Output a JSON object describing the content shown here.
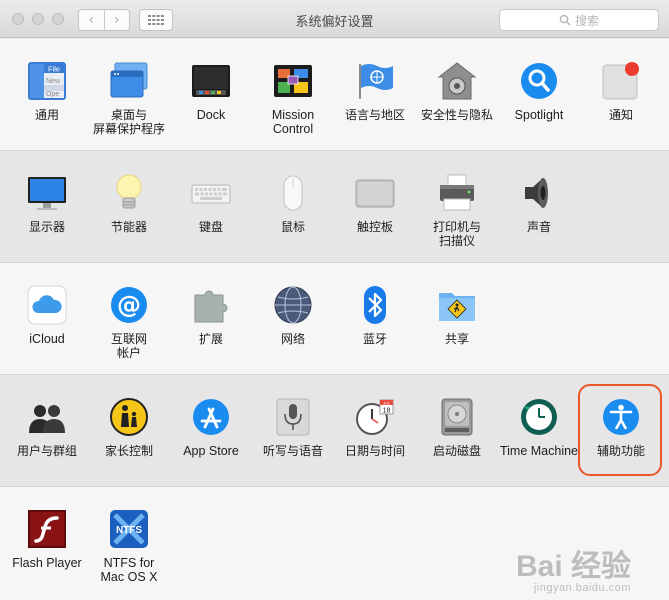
{
  "window": {
    "title": "系统偏好设置"
  },
  "toolbar": {
    "back": "‹",
    "forward": "›",
    "search_placeholder": "搜索"
  },
  "rows": [
    [
      {
        "name": "general",
        "label": "通用"
      },
      {
        "name": "desktop-screensaver",
        "label": "桌面与\n屏幕保护程序"
      },
      {
        "name": "dock",
        "label": "Dock"
      },
      {
        "name": "mission-control",
        "label": "Mission\nControl"
      },
      {
        "name": "language-region",
        "label": "语言与地区"
      },
      {
        "name": "security-privacy",
        "label": "安全性与隐私"
      },
      {
        "name": "spotlight",
        "label": "Spotlight"
      },
      {
        "name": "notifications",
        "label": "通知"
      }
    ],
    [
      {
        "name": "displays",
        "label": "显示器"
      },
      {
        "name": "energy-saver",
        "label": "节能器"
      },
      {
        "name": "keyboard",
        "label": "键盘"
      },
      {
        "name": "mouse",
        "label": "鼠标"
      },
      {
        "name": "trackpad",
        "label": "触控板"
      },
      {
        "name": "printers-scanners",
        "label": "打印机与\n扫描仪"
      },
      {
        "name": "sound",
        "label": "声音"
      }
    ],
    [
      {
        "name": "icloud",
        "label": "iCloud"
      },
      {
        "name": "internet-accounts",
        "label": "互联网\n帐户"
      },
      {
        "name": "extensions",
        "label": "扩展"
      },
      {
        "name": "network",
        "label": "网络"
      },
      {
        "name": "bluetooth",
        "label": "蓝牙"
      },
      {
        "name": "sharing",
        "label": "共享"
      }
    ],
    [
      {
        "name": "users-groups",
        "label": "用户与群组"
      },
      {
        "name": "parental-controls",
        "label": "家长控制"
      },
      {
        "name": "app-store",
        "label": "App Store"
      },
      {
        "name": "dictation-speech",
        "label": "听写与语音"
      },
      {
        "name": "date-time",
        "label": "日期与时间"
      },
      {
        "name": "startup-disk",
        "label": "启动磁盘"
      },
      {
        "name": "time-machine",
        "label": "Time Machine"
      },
      {
        "name": "accessibility",
        "label": "辅助功能"
      }
    ],
    [
      {
        "name": "flash-player",
        "label": "Flash Player"
      },
      {
        "name": "ntfs-for-mac",
        "label": "NTFS for\nMac OS X"
      }
    ]
  ],
  "icon_text": {
    "file_tag": "File",
    "file_new": "New",
    "file_ope": "Ope",
    "calendar_month": "JUL",
    "calendar_day": "18",
    "ntfs": "NTFS"
  },
  "watermark": {
    "text": "Bai 经验",
    "url": "jingyan.baidu.com"
  },
  "colors": {
    "highlight": "#e8562a",
    "accent_blue": "#1a8cf0"
  }
}
